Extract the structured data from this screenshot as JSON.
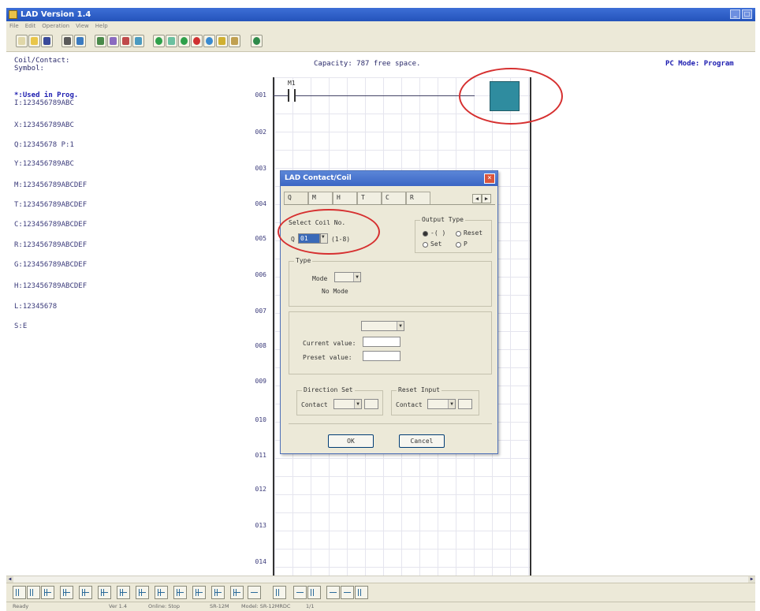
{
  "window": {
    "title": "LAD Version 1.4"
  },
  "menu": [
    "File",
    "Edit",
    "Operation",
    "View",
    "Help"
  ],
  "left_panel": {
    "header": [
      "Coil/Contact:",
      "Symbol:"
    ],
    "used_label": "*:Used in Prog.",
    "items": [
      "I:123456789ABC",
      "X:123456789ABC",
      "Q:12345678 P:1",
      "Y:123456789ABC",
      "M:123456789ABCDEF",
      "T:123456789ABCDEF",
      "C:123456789ABCDEF",
      "R:123456789ABCDEF",
      "G:123456789ABCDEF",
      "H:123456789ABCDEF",
      "L:12345678",
      "S:E"
    ]
  },
  "status_top": {
    "capacity": "Capacity: 787 free space.",
    "pc_mode": "PC Mode: Program"
  },
  "ladder": {
    "rung_numbers": [
      "001",
      "002",
      "003",
      "004",
      "005",
      "006",
      "007",
      "008",
      "009",
      "010",
      "011",
      "012",
      "013",
      "014"
    ],
    "contact_label": "M1"
  },
  "dialog": {
    "title": "LAD Contact/Coil",
    "tabs": [
      "Q",
      "M",
      "H",
      "T",
      "C",
      "R"
    ],
    "select_coil_label": "Select Coil No.",
    "coil_prefix": "Q",
    "coil_value": "01",
    "coil_range": "(1-8)",
    "output_type_label": "Output Type",
    "output_types": [
      "-( )",
      "Reset",
      "Set",
      "P"
    ],
    "mode_title": "Type",
    "mode_label": "Mode",
    "no_mode": "No Mode",
    "current_value_label": "Current value:",
    "preset_value_label": "Preset value:",
    "direction_set_label": "Direction Set",
    "reset_input_label": "Reset Input",
    "contact_label": "Contact",
    "ok_label": "OK",
    "cancel_label": "Cancel"
  },
  "statusbar": [
    "Ready",
    "Ver 1.4",
    "Online: Stop",
    "SR-12M",
    "Model: SR-12MRDC",
    "1/1"
  ],
  "colors": {
    "coil": "#2f8c9f",
    "highlight": "#d63030",
    "title": "#2453bb"
  }
}
